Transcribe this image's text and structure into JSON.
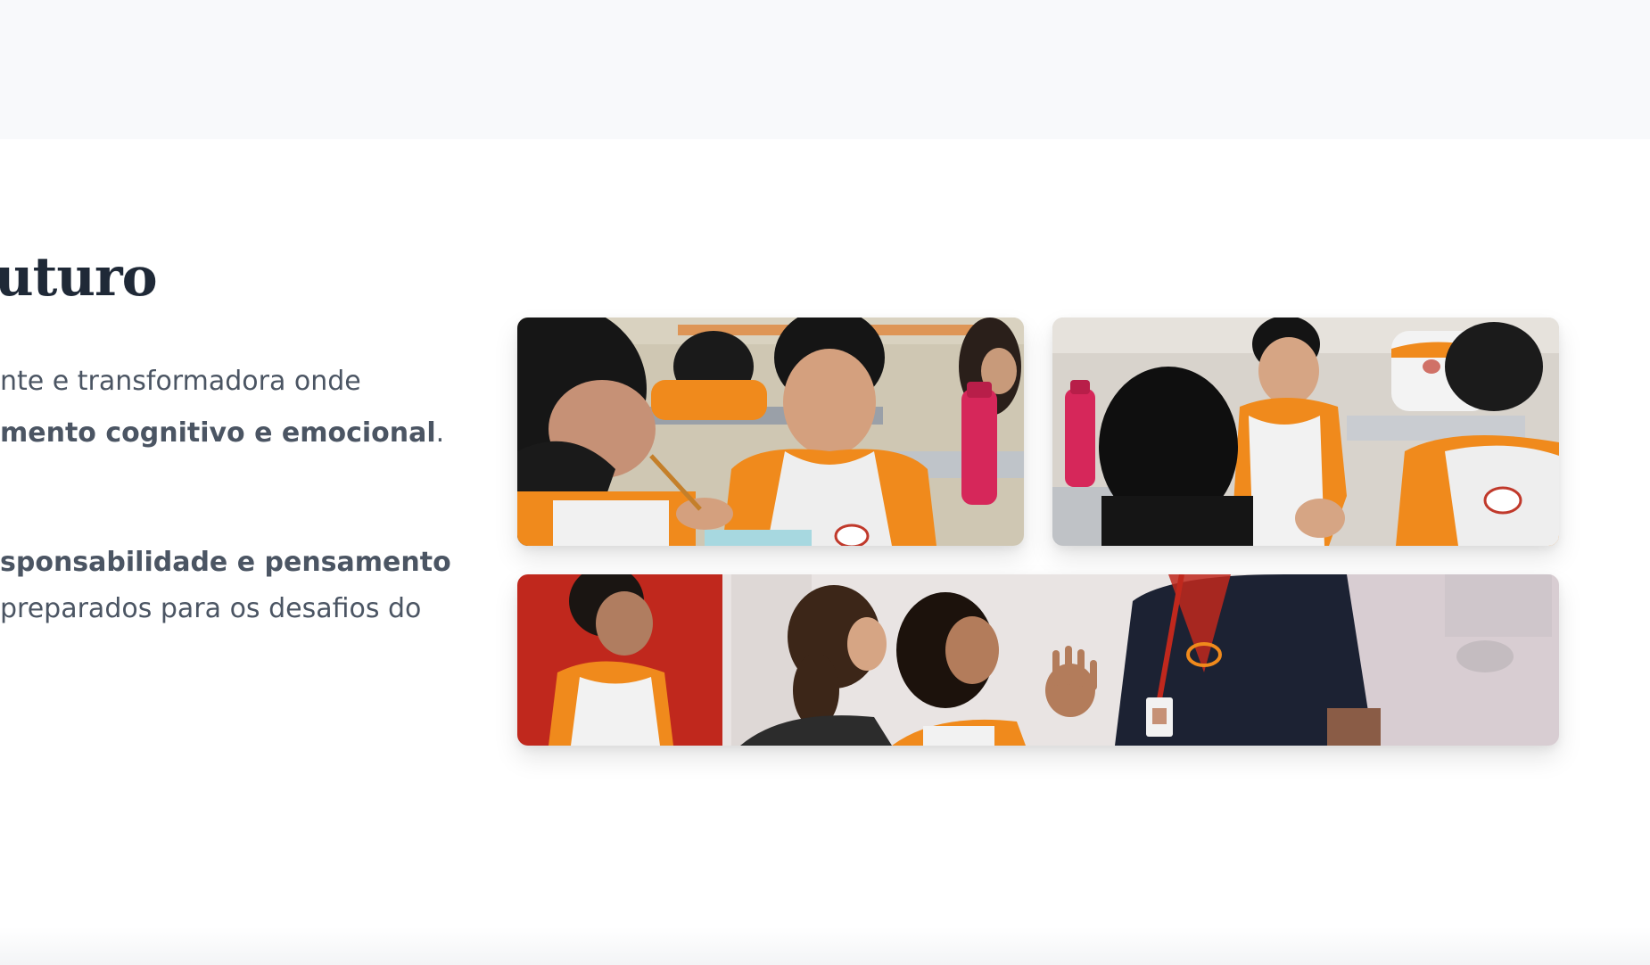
{
  "section": {
    "headline": "uturo",
    "paragraph1": {
      "line1": "nte e transformadora onde",
      "line2_bold": "mento cognitivo e emocional",
      "line2_tail": "."
    },
    "paragraph2": {
      "line1_bold": "sponsabilidade e pensamento",
      "line2": " preparados para os desafios do"
    }
  },
  "gallery": {
    "photos": [
      {
        "alt": "Aluno concentrado em sala de aula com garrafa rosa ao fundo"
      },
      {
        "alt": "Alunos em sala de aula, um deles olhando para a câmera"
      },
      {
        "alt": "Alunos conversando animadamente com um professor"
      }
    ]
  },
  "colors": {
    "heading": "#1f2937",
    "body_text": "#4b5563",
    "uniform_orange": "#f08a1c",
    "top_band": "#f8f9fb"
  }
}
